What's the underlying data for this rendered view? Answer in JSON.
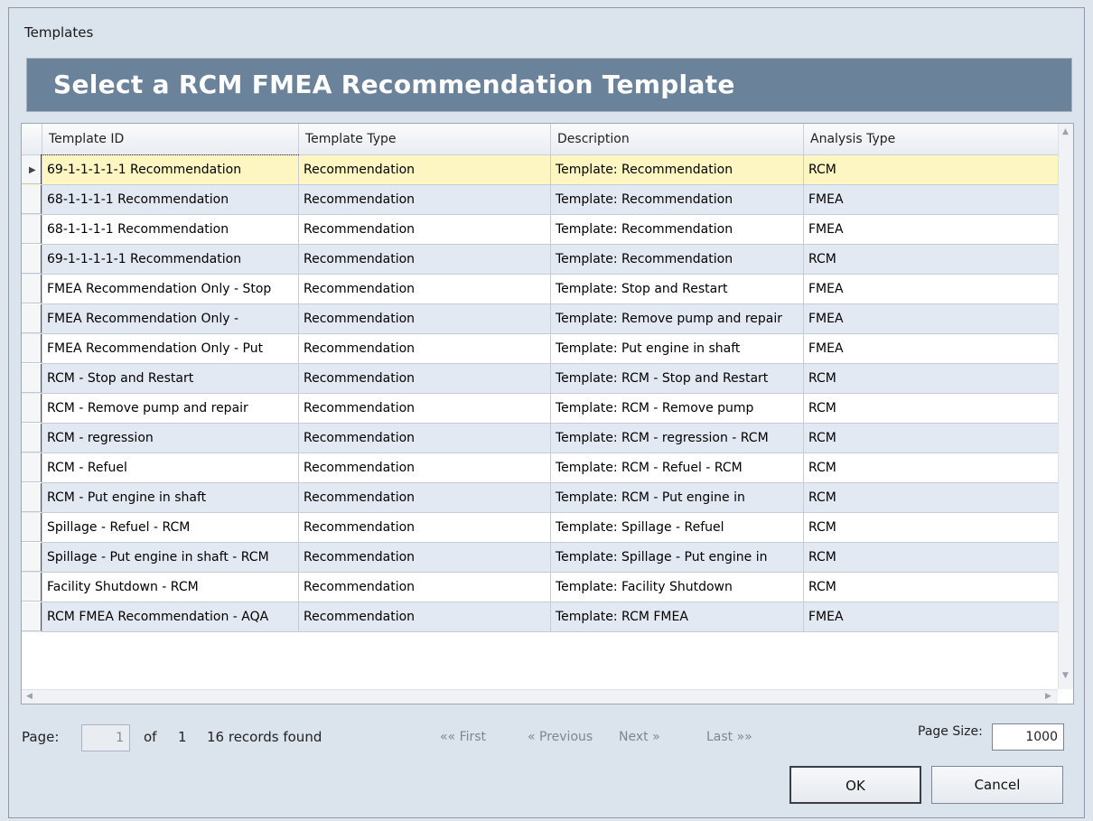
{
  "window": {
    "title": "Templates"
  },
  "banner": {
    "title": "Select a RCM FMEA Recommendation Template"
  },
  "grid": {
    "columns": [
      "Template ID",
      "Template Type",
      "Description",
      "Analysis Type"
    ],
    "rows": [
      [
        "69-1-1-1-1-1 Recommendation",
        "Recommendation",
        "Template: Recommendation",
        "RCM"
      ],
      [
        "68-1-1-1-1 Recommendation",
        "Recommendation",
        "Template: Recommendation",
        "FMEA"
      ],
      [
        "68-1-1-1-1 Recommendation",
        "Recommendation",
        "Template: Recommendation",
        "FMEA"
      ],
      [
        "69-1-1-1-1-1 Recommendation",
        "Recommendation",
        "Template: Recommendation",
        "RCM"
      ],
      [
        "FMEA Recommendation Only - Stop",
        "Recommendation",
        "Template: Stop and Restart",
        "FMEA"
      ],
      [
        "FMEA Recommendation Only -",
        "Recommendation",
        "Template: Remove pump and repair",
        "FMEA"
      ],
      [
        "FMEA Recommendation Only - Put",
        "Recommendation",
        "Template: Put engine in shaft",
        "FMEA"
      ],
      [
        "RCM -  Stop and Restart",
        "Recommendation",
        "Template: RCM -  Stop and Restart",
        "RCM"
      ],
      [
        "RCM -  Remove pump and repair",
        "Recommendation",
        "Template: RCM -  Remove pump",
        "RCM"
      ],
      [
        "RCM -  regression",
        "Recommendation",
        "Template: RCM -  regression - RCM",
        "RCM"
      ],
      [
        "RCM -  Refuel",
        "Recommendation",
        "Template: RCM -  Refuel - RCM",
        "RCM"
      ],
      [
        "RCM -  Put engine in shaft",
        "Recommendation",
        "Template: RCM -  Put engine in",
        "RCM"
      ],
      [
        "Spillage -  Refuel  - RCM",
        "Recommendation",
        "Template: Spillage -  Refuel",
        "RCM"
      ],
      [
        "Spillage -  Put engine in shaft - RCM",
        "Recommendation",
        "Template: Spillage -  Put engine in",
        "RCM"
      ],
      [
        "Facility Shutdown - RCM",
        "Recommendation",
        "Template: Facility Shutdown",
        "RCM"
      ],
      [
        "RCM FMEA Recommendation - AQA",
        "Recommendation",
        "Template: RCM FMEA",
        "FMEA"
      ]
    ],
    "selected_row": 0,
    "colors": {
      "selected": "#fdf6c3",
      "alt": "#e3e9f2",
      "normal": "#ffffff"
    }
  },
  "pager": {
    "page_label": "Page:",
    "page_value": "1",
    "of_label": "of",
    "total_pages": "1",
    "records": "16 records found",
    "first": "«« First",
    "previous": "« Previous",
    "next": "Next »",
    "last": "Last »»",
    "page_size_label": "Page Size:",
    "page_size_value": "1000"
  },
  "buttons": {
    "ok": "OK",
    "cancel": "Cancel"
  }
}
